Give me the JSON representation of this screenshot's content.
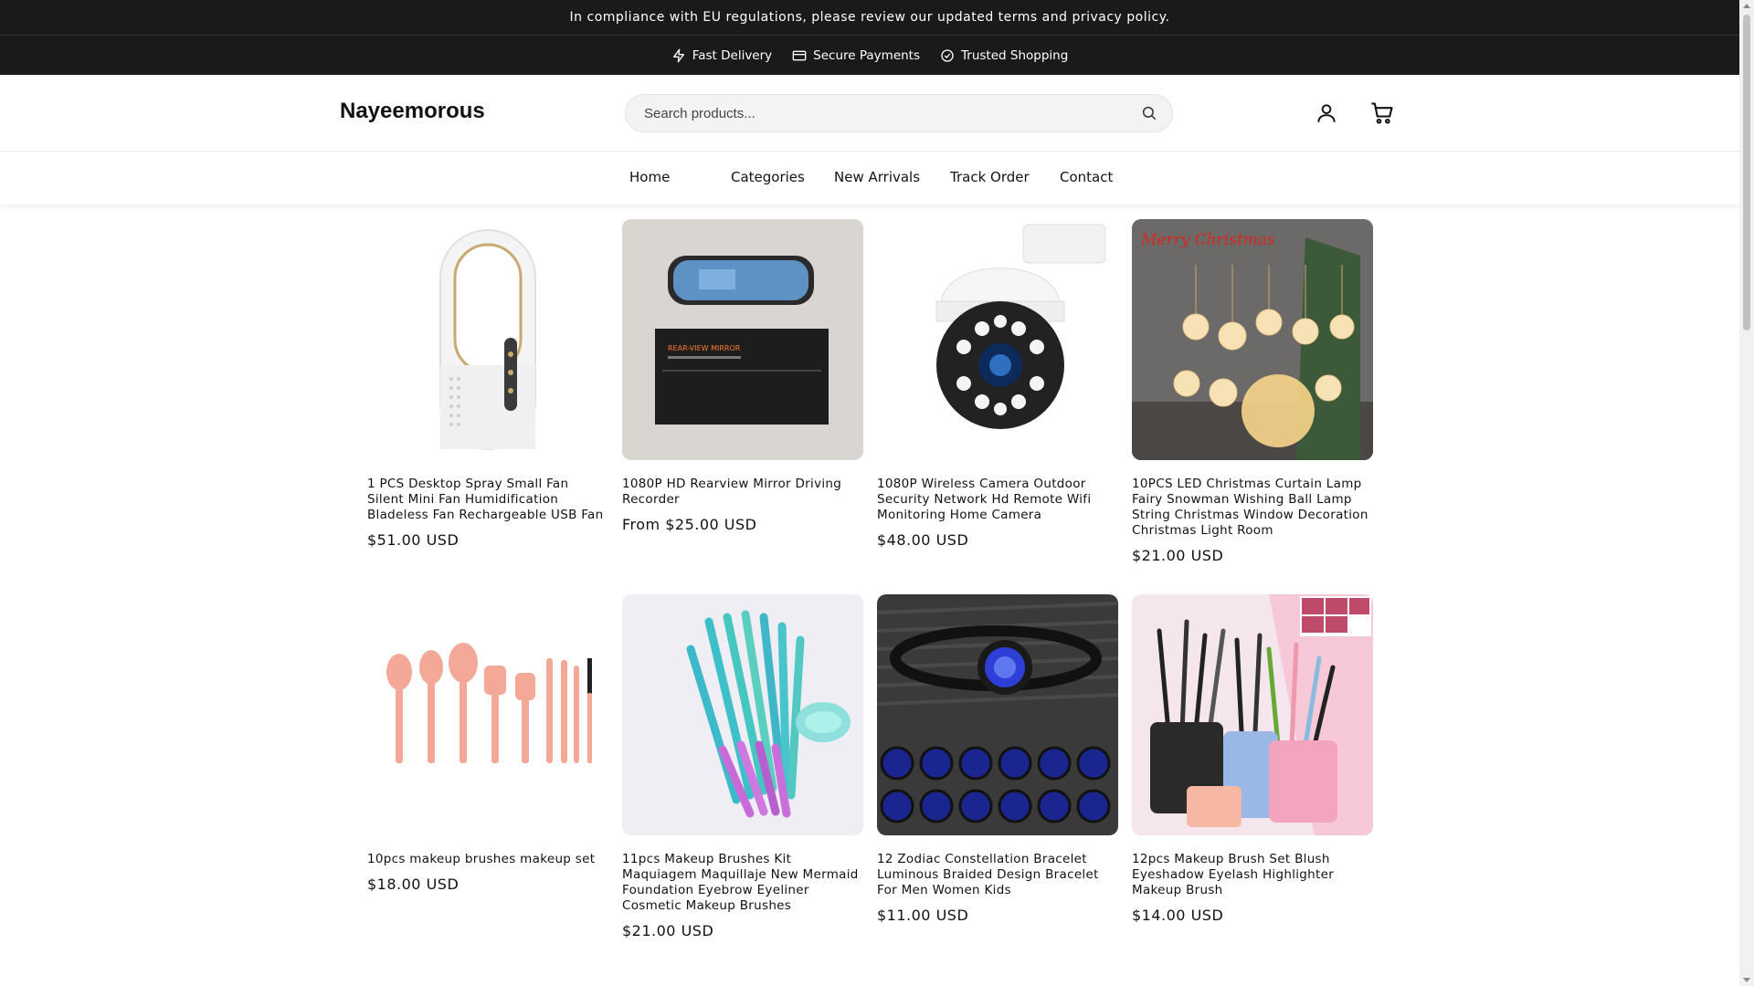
{
  "announcement": "In compliance with EU regulations, please review our updated terms and privacy policy.",
  "trust": [
    {
      "icon": "lightning-icon",
      "label": "Fast Delivery"
    },
    {
      "icon": "card-icon",
      "label": "Secure Payments"
    },
    {
      "icon": "check-circle-icon",
      "label": "Trusted Shopping"
    }
  ],
  "header": {
    "logo": "Nayeemorous",
    "search_placeholder": "Search products..."
  },
  "nav": [
    "Home",
    "Categories",
    "New Arrivals",
    "Track Order",
    "Contact"
  ],
  "products": [
    {
      "title": "1 PCS Desktop Spray Small Fan Silent Mini Fan Humidification Bladeless Fan Rechargeable USB Fan",
      "price": "$51.00 USD"
    },
    {
      "title": "1080P HD Rearview Mirror Driving Recorder",
      "price": "From $25.00 USD",
      "image_text": "REAR-VIEW MIRROR"
    },
    {
      "title": "1080P Wireless Camera Outdoor Security Network Hd Remote Wifi Monitoring Home Camera",
      "price": "$48.00 USD"
    },
    {
      "title": "10PCS LED Christmas Curtain Lamp Fairy Snowman Wishing Ball Lamp String Christmas Window Decoration Christmas Light Room",
      "price": "$21.00 USD",
      "image_text": "Merry Christmas"
    },
    {
      "title": "10pcs makeup brushes makeup set",
      "price": "$18.00 USD"
    },
    {
      "title": "11pcs Makeup Brushes Kit Maquiagem Maquillaje New Mermaid Foundation Eyebrow Eyeliner Cosmetic Makeup Brushes",
      "price": "$21.00 USD"
    },
    {
      "title": "12 Zodiac Constellation Bracelet Luminous Braided Design Bracelet For Men Women Kids",
      "price": "$11.00 USD"
    },
    {
      "title": "12pcs Makeup Brush Set Blush Eyeshadow Eyelash Highlighter Makeup Brush",
      "price": "$14.00 USD"
    }
  ],
  "colors": {
    "topbar": "#1a1a1a",
    "text": "#121212",
    "search_bg": "#f3f3f3"
  }
}
